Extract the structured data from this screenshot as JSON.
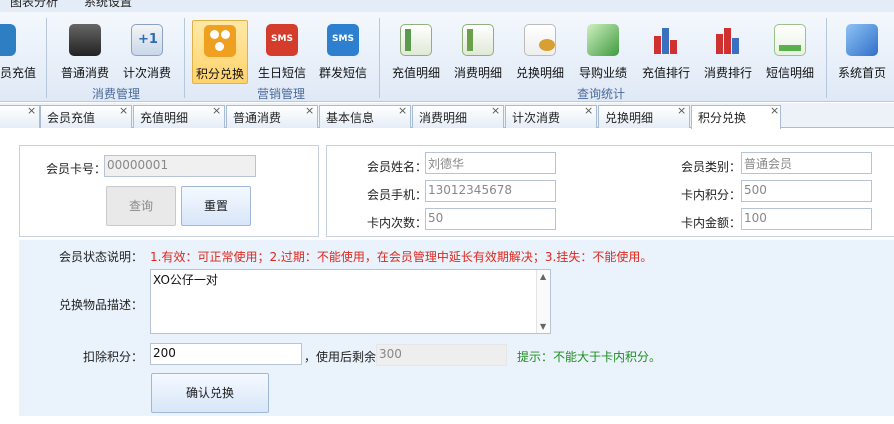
{
  "menu": {
    "items": [
      "图表分析",
      "系统设置"
    ]
  },
  "ribbon": {
    "buttons": [
      {
        "label": "员充值",
        "icon": "drop-icon",
        "color": "#2e7ec4"
      },
      {
        "label": "普通消费",
        "icon": "cash-register-icon",
        "color": "#444444"
      },
      {
        "label": "计次消费",
        "icon": "counter-icon",
        "color": "#2d6bb5"
      },
      {
        "label": "积分兑换",
        "icon": "points-exchange-icon",
        "color": "#f0a020"
      },
      {
        "label": "生日短信",
        "icon": "sms-icon",
        "color": "#d43c2c"
      },
      {
        "label": "群发短信",
        "icon": "sms-broadcast-icon",
        "color": "#2d7fd0"
      },
      {
        "label": "充值明细",
        "icon": "recharge-detail-icon",
        "color": "#5a9a4a"
      },
      {
        "label": "消费明细",
        "icon": "consume-detail-icon",
        "color": "#6aa04a"
      },
      {
        "label": "兑换明细",
        "icon": "coins-icon",
        "color": "#d8a030"
      },
      {
        "label": "导购业绩",
        "icon": "growth-chart-icon",
        "color": "#3f9a3f"
      },
      {
        "label": "充值排行",
        "icon": "bar-chart-icon",
        "color": "#d03030"
      },
      {
        "label": "消费排行",
        "icon": "bar-chart-icon",
        "color": "#3a70c0"
      },
      {
        "label": "短信明细",
        "icon": "message-list-icon",
        "color": "#5ab04a"
      },
      {
        "label": "系统首页",
        "icon": "home-compass-icon",
        "color": "#2f6fc8"
      }
    ],
    "groups": {
      "consume": "消费管理",
      "marketing": "营销管理",
      "stats": "查询统计"
    }
  },
  "tabs": [
    {
      "label": ""
    },
    {
      "label": "会员充值"
    },
    {
      "label": "充值明细"
    },
    {
      "label": "普通消费"
    },
    {
      "label": "基本信息"
    },
    {
      "label": "消费明细"
    },
    {
      "label": "计次消费"
    },
    {
      "label": "兑换明细"
    },
    {
      "label": "积分兑换"
    }
  ],
  "tab_close": "×",
  "query": {
    "card_label": "会员卡号：",
    "card_value": "00000001",
    "query_btn": "查询",
    "reset_btn": "重置"
  },
  "member": {
    "name_label": "会员姓名：",
    "name_value": "刘德华",
    "phone_label": "会员手机：",
    "phone_value": "13012345678",
    "count_label": "卡内次数：",
    "count_value": "50",
    "type_label": "会员类别：",
    "type_value": "普通会员",
    "points_label": "卡内积分：",
    "points_value": "500",
    "amount_label": "卡内金额：",
    "amount_value": "100"
  },
  "form": {
    "status_label": "会员状态说明：",
    "status_text": "1.有效：可正常使用；2.过期：不能使用，在会员管理中延长有效期解决；3.挂失：不能使用。",
    "desc_label": "兑换物品描述：",
    "desc_value": "XO公仔一对",
    "deduct_label": "扣除积分：",
    "deduct_value": "200",
    "remain_label": "，使用后剩余",
    "remain_value": "300",
    "hint": "提示：不能大于卡内积分。",
    "confirm_btn": "确认兑换"
  },
  "colors": {
    "status_red": "#e0281e",
    "hint_green": "#1f8f1f",
    "ribbon_active": "#ffd36b"
  }
}
